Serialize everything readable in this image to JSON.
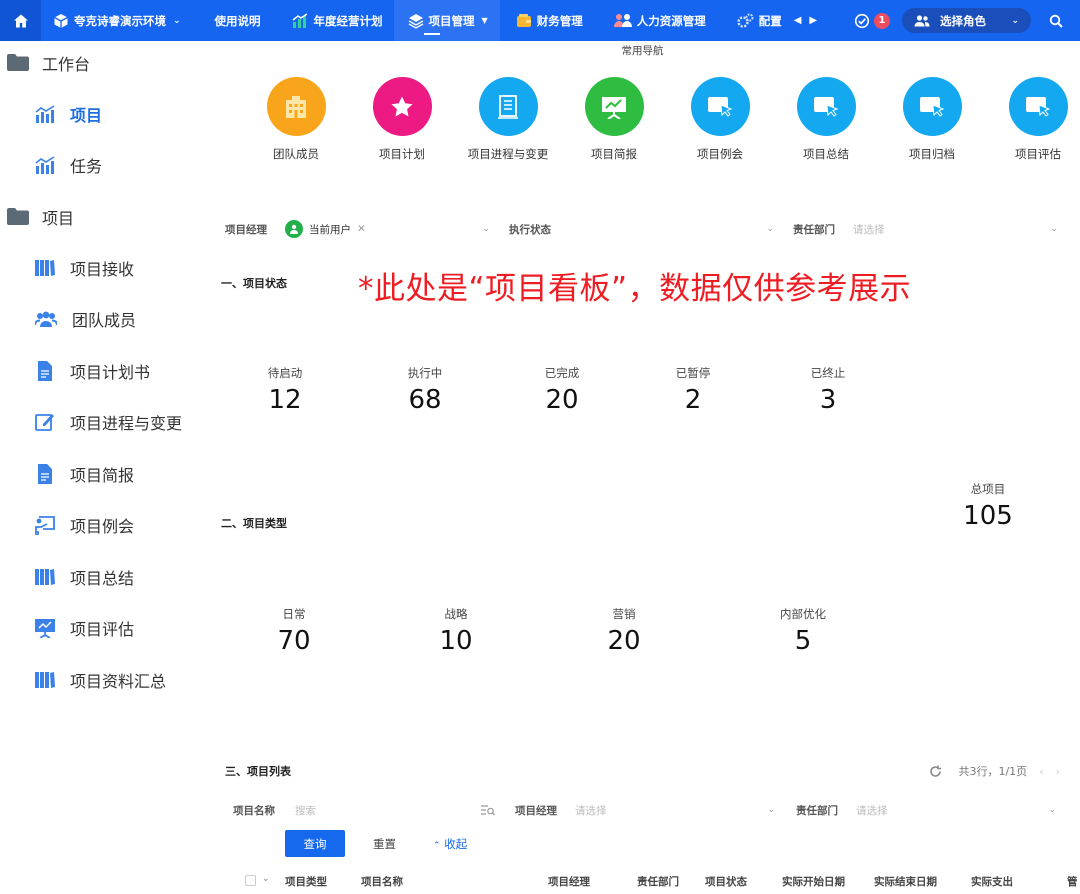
{
  "topbar": {
    "org_name": "夸克诗睿演示环境",
    "menu": [
      {
        "label": "使用说明"
      },
      {
        "label": "年度经营计划"
      },
      {
        "label": "项目管理"
      },
      {
        "label": "财务管理"
      },
      {
        "label": "人力资源管理"
      },
      {
        "label": "配置"
      }
    ],
    "notification_count": "1",
    "role_label": "选择角色"
  },
  "sidebar": {
    "groups": [
      {
        "label": "工作台",
        "items": [
          {
            "label": "项目"
          },
          {
            "label": "任务"
          }
        ]
      },
      {
        "label": "项目",
        "items": [
          {
            "label": "项目接收"
          },
          {
            "label": "团队成员"
          },
          {
            "label": "项目计划书"
          },
          {
            "label": "项目进程与变更"
          },
          {
            "label": "项目简报"
          },
          {
            "label": "项目例会"
          },
          {
            "label": "项目总结"
          },
          {
            "label": "项目评估"
          },
          {
            "label": "项目资料汇总"
          }
        ]
      }
    ]
  },
  "main": {
    "nav_title": "常用导航",
    "quick_nav": [
      {
        "label": "团队成员",
        "color": "#f8a51c"
      },
      {
        "label": "项目计划",
        "color": "#ee1a83"
      },
      {
        "label": "项目进程与变更",
        "color": "#13a8f0"
      },
      {
        "label": "项目简报",
        "color": "#2ebd41"
      },
      {
        "label": "项目例会",
        "color": "#13a8f0"
      },
      {
        "label": "项目总结",
        "color": "#13a8f0"
      },
      {
        "label": "项目归档",
        "color": "#13a8f0"
      },
      {
        "label": "项目评估",
        "color": "#13a8f0"
      }
    ],
    "filters": {
      "manager_label": "项目经理",
      "manager_value": "当前用户",
      "status_label": "执行状态",
      "dept_label": "责任部门",
      "dept_placeholder": "请选择"
    },
    "notice": "*此处是“项目看板”，数据仅供参考展示",
    "section1": {
      "title": "一、项目状态",
      "stats": [
        {
          "label": "待启动",
          "value": "12"
        },
        {
          "label": "执行中",
          "value": "68"
        },
        {
          "label": "已完成",
          "value": "20"
        },
        {
          "label": "已暂停",
          "value": "2"
        },
        {
          "label": "已终止",
          "value": "3"
        }
      ],
      "total_label": "总项目",
      "total_value": "105"
    },
    "section2": {
      "title": "二、项目类型",
      "stats": [
        {
          "label": "日常",
          "value": "70"
        },
        {
          "label": "战略",
          "value": "10"
        },
        {
          "label": "营销",
          "value": "20"
        },
        {
          "label": "内部优化",
          "value": "5"
        }
      ]
    },
    "section3": {
      "title": "三、项目列表",
      "pager_text": "共3行，1/1页",
      "query": {
        "name_label": "项目名称",
        "name_placeholder": "搜索",
        "manager_label": "项目经理",
        "manager_placeholder": "请选择",
        "dept_label": "责任部门",
        "dept_placeholder": "请选择"
      },
      "query_button": "查询",
      "reset_button": "重置",
      "collapse_button": "收起",
      "columns": [
        "项目类型",
        "项目名称",
        "项目经理",
        "责任部门",
        "项目状态",
        "实际开始日期",
        "实际结束日期",
        "实际支出",
        "管"
      ]
    }
  }
}
